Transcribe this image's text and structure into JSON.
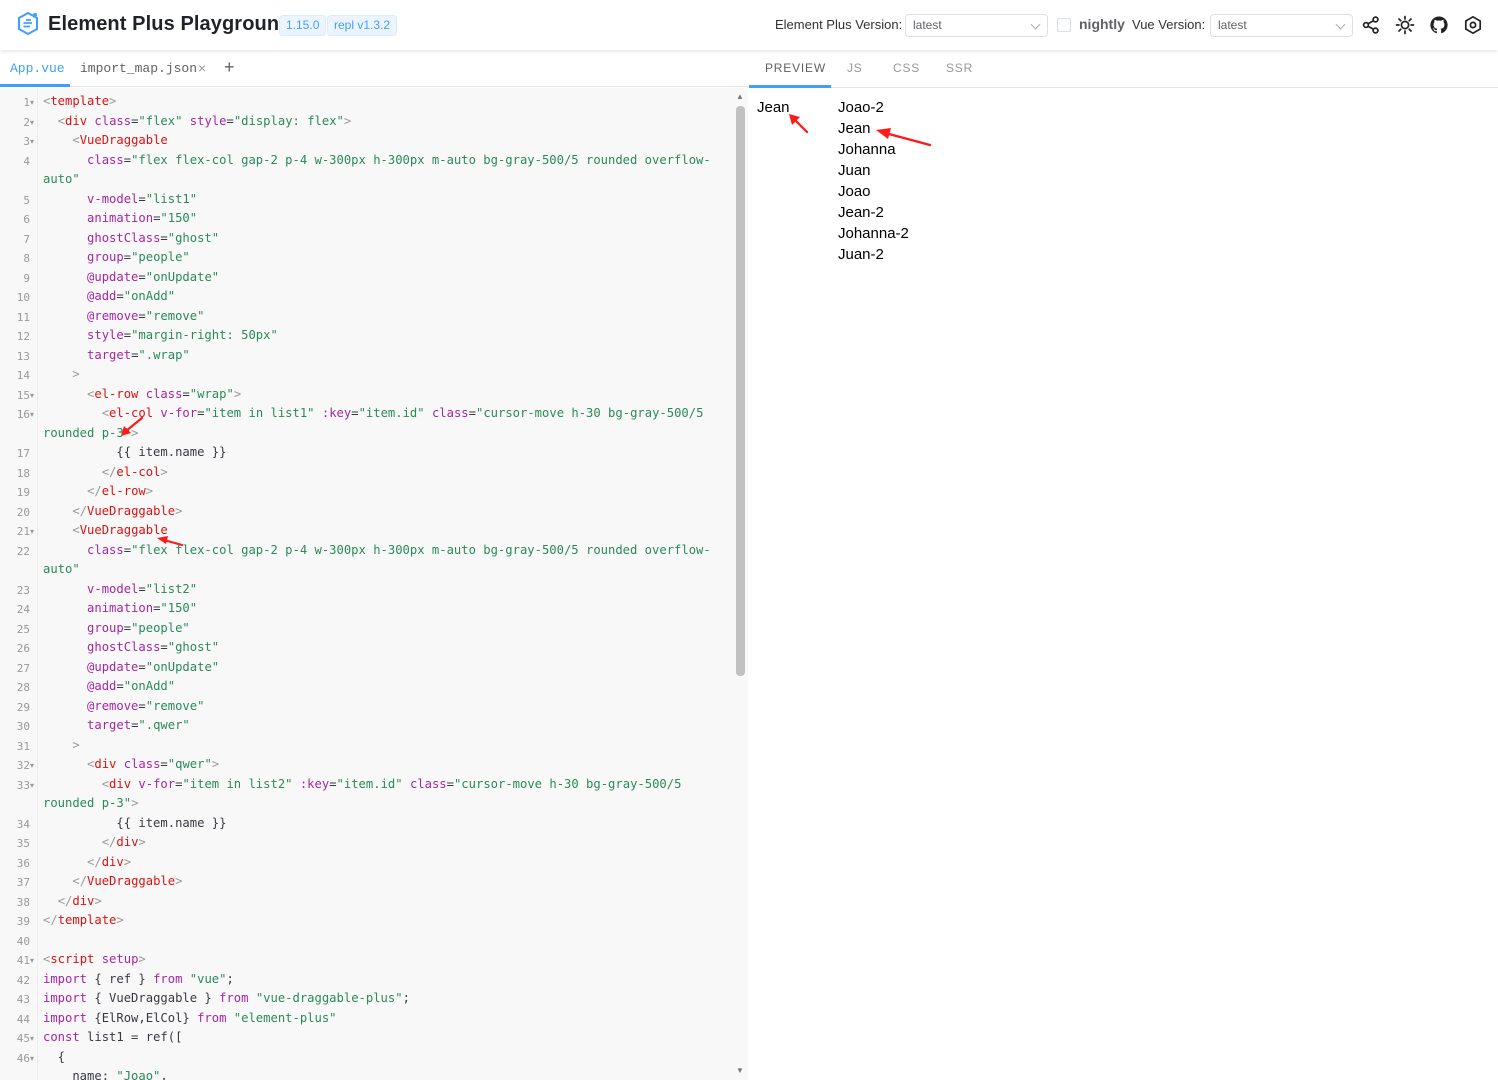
{
  "header": {
    "title": "Element Plus Playground",
    "badges": [
      "1.15.0",
      "repl v1.3.2"
    ],
    "ep_version_label": "Element Plus Version:",
    "ep_version_value": "latest",
    "nightly_label": "nightly",
    "vue_version_label": "Vue Version:",
    "vue_version_value": "latest",
    "icons": [
      "share-icon",
      "sun-icon",
      "github-icon",
      "settings-icon"
    ]
  },
  "file_tabs": [
    "App.vue",
    "import_map.json",
    "×",
    "+"
  ],
  "preview_tabs": [
    "PREVIEW",
    "JS",
    "CSS",
    "SSR"
  ],
  "code": [
    {
      "n": "1",
      "f": true,
      "t": [
        [
          "p",
          "<"
        ],
        [
          "t",
          "template"
        ],
        [
          "p",
          ">"
        ]
      ]
    },
    {
      "n": "2",
      "f": true,
      "t": [
        [
          "d",
          "  "
        ],
        [
          "p",
          "<"
        ],
        [
          "t",
          "div"
        ],
        [
          "d",
          " "
        ],
        [
          "a",
          "class"
        ],
        [
          "d",
          "="
        ],
        [
          "s",
          "\"flex\""
        ],
        [
          "d",
          " "
        ],
        [
          "a",
          "style"
        ],
        [
          "d",
          "="
        ],
        [
          "s",
          "\"display: flex\""
        ],
        [
          "p",
          ">"
        ]
      ]
    },
    {
      "n": "3",
      "f": true,
      "t": [
        [
          "d",
          "    "
        ],
        [
          "p",
          "<"
        ],
        [
          "t",
          "VueDraggable"
        ]
      ]
    },
    {
      "n": "4",
      "f": false,
      "t": [
        [
          "d",
          "      "
        ],
        [
          "a",
          "class"
        ],
        [
          "d",
          "="
        ],
        [
          "s",
          "\"flex flex-col gap-2 p-4 w-300px h-300px m-auto bg-gray-500/5 rounded overflow-"
        ]
      ]
    },
    {
      "n": "",
      "f": false,
      "t": [
        [
          "s",
          "auto\""
        ]
      ]
    },
    {
      "n": "5",
      "f": false,
      "t": [
        [
          "d",
          "      "
        ],
        [
          "a",
          "v-model"
        ],
        [
          "d",
          "="
        ],
        [
          "s",
          "\"list1\""
        ]
      ]
    },
    {
      "n": "6",
      "f": false,
      "t": [
        [
          "d",
          "      "
        ],
        [
          "a",
          "animation"
        ],
        [
          "d",
          "="
        ],
        [
          "s",
          "\"150\""
        ]
      ]
    },
    {
      "n": "7",
      "f": false,
      "t": [
        [
          "d",
          "      "
        ],
        [
          "a",
          "ghostClass"
        ],
        [
          "d",
          "="
        ],
        [
          "s",
          "\"ghost\""
        ]
      ]
    },
    {
      "n": "8",
      "f": false,
      "t": [
        [
          "d",
          "      "
        ],
        [
          "a",
          "group"
        ],
        [
          "d",
          "="
        ],
        [
          "s",
          "\"people\""
        ]
      ]
    },
    {
      "n": "9",
      "f": false,
      "t": [
        [
          "d",
          "      "
        ],
        [
          "a",
          "@update"
        ],
        [
          "d",
          "="
        ],
        [
          "s",
          "\"onUpdate\""
        ]
      ]
    },
    {
      "n": "10",
      "f": false,
      "t": [
        [
          "d",
          "      "
        ],
        [
          "a",
          "@add"
        ],
        [
          "d",
          "="
        ],
        [
          "s",
          "\"onAdd\""
        ]
      ]
    },
    {
      "n": "11",
      "f": false,
      "t": [
        [
          "d",
          "      "
        ],
        [
          "a",
          "@remove"
        ],
        [
          "d",
          "="
        ],
        [
          "s",
          "\"remove\""
        ]
      ]
    },
    {
      "n": "12",
      "f": false,
      "t": [
        [
          "d",
          "      "
        ],
        [
          "a",
          "style"
        ],
        [
          "d",
          "="
        ],
        [
          "s",
          "\"margin-right: 50px\""
        ]
      ]
    },
    {
      "n": "13",
      "f": false,
      "t": [
        [
          "d",
          "      "
        ],
        [
          "a",
          "target"
        ],
        [
          "d",
          "="
        ],
        [
          "s",
          "\".wrap\""
        ]
      ]
    },
    {
      "n": "14",
      "f": false,
      "t": [
        [
          "d",
          "    "
        ],
        [
          "p",
          ">"
        ]
      ]
    },
    {
      "n": "15",
      "f": true,
      "t": [
        [
          "d",
          "      "
        ],
        [
          "p",
          "<"
        ],
        [
          "t",
          "el-row"
        ],
        [
          "d",
          " "
        ],
        [
          "a",
          "class"
        ],
        [
          "d",
          "="
        ],
        [
          "s",
          "\"wrap\""
        ],
        [
          "p",
          ">"
        ]
      ]
    },
    {
      "n": "16",
      "f": true,
      "t": [
        [
          "d",
          "        "
        ],
        [
          "p",
          "<"
        ],
        [
          "t",
          "el-col"
        ],
        [
          "d",
          " "
        ],
        [
          "a",
          "v-for"
        ],
        [
          "d",
          "="
        ],
        [
          "s",
          "\"item in list1\""
        ],
        [
          "d",
          " "
        ],
        [
          "a",
          ":key"
        ],
        [
          "d",
          "="
        ],
        [
          "s",
          "\"item.id\""
        ],
        [
          "d",
          " "
        ],
        [
          "a",
          "class"
        ],
        [
          "d",
          "="
        ],
        [
          "s",
          "\"cursor-move h-30 bg-gray-500/5"
        ]
      ]
    },
    {
      "n": "",
      "f": false,
      "t": [
        [
          "s",
          "rounded p-3\""
        ],
        [
          "p",
          ">"
        ]
      ]
    },
    {
      "n": "17",
      "f": false,
      "t": [
        [
          "d",
          "          {{ item.name }}"
        ]
      ]
    },
    {
      "n": "18",
      "f": false,
      "t": [
        [
          "d",
          "        "
        ],
        [
          "p",
          "</"
        ],
        [
          "t",
          "el-col"
        ],
        [
          "p",
          ">"
        ]
      ]
    },
    {
      "n": "19",
      "f": false,
      "t": [
        [
          "d",
          "      "
        ],
        [
          "p",
          "</"
        ],
        [
          "t",
          "el-row"
        ],
        [
          "p",
          ">"
        ]
      ]
    },
    {
      "n": "20",
      "f": false,
      "t": [
        [
          "d",
          "    "
        ],
        [
          "p",
          "</"
        ],
        [
          "t",
          "VueDraggable"
        ],
        [
          "p",
          ">"
        ]
      ]
    },
    {
      "n": "21",
      "f": true,
      "t": [
        [
          "d",
          "    "
        ],
        [
          "p",
          "<"
        ],
        [
          "t",
          "VueDraggable"
        ]
      ]
    },
    {
      "n": "22",
      "f": false,
      "t": [
        [
          "d",
          "      "
        ],
        [
          "a",
          "class"
        ],
        [
          "d",
          "="
        ],
        [
          "s",
          "\"flex flex-col gap-2 p-4 w-300px h-300px m-auto bg-gray-500/5 rounded overflow-"
        ]
      ]
    },
    {
      "n": "",
      "f": false,
      "t": [
        [
          "s",
          "auto\""
        ]
      ]
    },
    {
      "n": "23",
      "f": false,
      "t": [
        [
          "d",
          "      "
        ],
        [
          "a",
          "v-model"
        ],
        [
          "d",
          "="
        ],
        [
          "s",
          "\"list2\""
        ]
      ]
    },
    {
      "n": "24",
      "f": false,
      "t": [
        [
          "d",
          "      "
        ],
        [
          "a",
          "animation"
        ],
        [
          "d",
          "="
        ],
        [
          "s",
          "\"150\""
        ]
      ]
    },
    {
      "n": "25",
      "f": false,
      "t": [
        [
          "d",
          "      "
        ],
        [
          "a",
          "group"
        ],
        [
          "d",
          "="
        ],
        [
          "s",
          "\"people\""
        ]
      ]
    },
    {
      "n": "26",
      "f": false,
      "t": [
        [
          "d",
          "      "
        ],
        [
          "a",
          "ghostClass"
        ],
        [
          "d",
          "="
        ],
        [
          "s",
          "\"ghost\""
        ]
      ]
    },
    {
      "n": "27",
      "f": false,
      "t": [
        [
          "d",
          "      "
        ],
        [
          "a",
          "@update"
        ],
        [
          "d",
          "="
        ],
        [
          "s",
          "\"onUpdate\""
        ]
      ]
    },
    {
      "n": "28",
      "f": false,
      "t": [
        [
          "d",
          "      "
        ],
        [
          "a",
          "@add"
        ],
        [
          "d",
          "="
        ],
        [
          "s",
          "\"onAdd\""
        ]
      ]
    },
    {
      "n": "29",
      "f": false,
      "t": [
        [
          "d",
          "      "
        ],
        [
          "a",
          "@remove"
        ],
        [
          "d",
          "="
        ],
        [
          "s",
          "\"remove\""
        ]
      ]
    },
    {
      "n": "30",
      "f": false,
      "t": [
        [
          "d",
          "      "
        ],
        [
          "a",
          "target"
        ],
        [
          "d",
          "="
        ],
        [
          "s",
          "\".qwer\""
        ]
      ]
    },
    {
      "n": "31",
      "f": false,
      "t": [
        [
          "d",
          "    "
        ],
        [
          "p",
          ">"
        ]
      ]
    },
    {
      "n": "32",
      "f": true,
      "t": [
        [
          "d",
          "      "
        ],
        [
          "p",
          "<"
        ],
        [
          "t",
          "div"
        ],
        [
          "d",
          " "
        ],
        [
          "a",
          "class"
        ],
        [
          "d",
          "="
        ],
        [
          "s",
          "\"qwer\""
        ],
        [
          "p",
          ">"
        ]
      ]
    },
    {
      "n": "33",
      "f": true,
      "t": [
        [
          "d",
          "        "
        ],
        [
          "p",
          "<"
        ],
        [
          "t",
          "div"
        ],
        [
          "d",
          " "
        ],
        [
          "a",
          "v-for"
        ],
        [
          "d",
          "="
        ],
        [
          "s",
          "\"item in list2\""
        ],
        [
          "d",
          " "
        ],
        [
          "a",
          ":key"
        ],
        [
          "d",
          "="
        ],
        [
          "s",
          "\"item.id\""
        ],
        [
          "d",
          " "
        ],
        [
          "a",
          "class"
        ],
        [
          "d",
          "="
        ],
        [
          "s",
          "\"cursor-move h-30 bg-gray-500/5"
        ]
      ]
    },
    {
      "n": "",
      "f": false,
      "t": [
        [
          "s",
          "rounded p-3\""
        ],
        [
          "p",
          ">"
        ]
      ]
    },
    {
      "n": "34",
      "f": false,
      "t": [
        [
          "d",
          "          {{ item.name }}"
        ]
      ]
    },
    {
      "n": "35",
      "f": false,
      "t": [
        [
          "d",
          "        "
        ],
        [
          "p",
          "</"
        ],
        [
          "t",
          "div"
        ],
        [
          "p",
          ">"
        ]
      ]
    },
    {
      "n": "36",
      "f": false,
      "t": [
        [
          "d",
          "      "
        ],
        [
          "p",
          "</"
        ],
        [
          "t",
          "div"
        ],
        [
          "p",
          ">"
        ]
      ]
    },
    {
      "n": "37",
      "f": false,
      "t": [
        [
          "d",
          "    "
        ],
        [
          "p",
          "</"
        ],
        [
          "t",
          "VueDraggable"
        ],
        [
          "p",
          ">"
        ]
      ]
    },
    {
      "n": "38",
      "f": false,
      "t": [
        [
          "d",
          "  "
        ],
        [
          "p",
          "</"
        ],
        [
          "t",
          "div"
        ],
        [
          "p",
          ">"
        ]
      ]
    },
    {
      "n": "39",
      "f": false,
      "t": [
        [
          "p",
          "</"
        ],
        [
          "t",
          "template"
        ],
        [
          "p",
          ">"
        ]
      ]
    },
    {
      "n": "40",
      "f": false,
      "t": [
        [
          "d",
          ""
        ]
      ]
    },
    {
      "n": "41",
      "f": true,
      "t": [
        [
          "p",
          "<"
        ],
        [
          "t",
          "script"
        ],
        [
          "d",
          " "
        ],
        [
          "a",
          "setup"
        ],
        [
          "p",
          ">"
        ]
      ]
    },
    {
      "n": "42",
      "f": false,
      "t": [
        [
          "k",
          "import"
        ],
        [
          "d",
          " { ref } "
        ],
        [
          "k",
          "from"
        ],
        [
          "d",
          " "
        ],
        [
          "s",
          "\"vue\""
        ],
        [
          "d",
          ";"
        ]
      ]
    },
    {
      "n": "43",
      "f": false,
      "t": [
        [
          "k",
          "import"
        ],
        [
          "d",
          " { VueDraggable } "
        ],
        [
          "k",
          "from"
        ],
        [
          "d",
          " "
        ],
        [
          "s",
          "\"vue-draggable-plus\""
        ],
        [
          "d",
          ";"
        ]
      ]
    },
    {
      "n": "44",
      "f": false,
      "t": [
        [
          "k",
          "import"
        ],
        [
          "d",
          " {ElRow,ElCol} "
        ],
        [
          "k",
          "from"
        ],
        [
          "d",
          " "
        ],
        [
          "s",
          "\"element-plus\""
        ]
      ]
    },
    {
      "n": "45",
      "f": true,
      "t": [
        [
          "k",
          "const"
        ],
        [
          "d",
          " list1 = ref(["
        ]
      ]
    },
    {
      "n": "46",
      "f": true,
      "t": [
        [
          "d",
          "  {"
        ]
      ]
    },
    {
      "n": "",
      "f": false,
      "t": [
        [
          "d",
          "    name: "
        ],
        [
          "s",
          "\"Joao\""
        ],
        [
          "d",
          ","
        ]
      ]
    }
  ],
  "preview": {
    "list1": [
      "Jean"
    ],
    "list2": [
      "Joao-2",
      "Jean",
      "Johanna",
      "Juan",
      "Joao",
      "Jean-2",
      "Johanna-2",
      "Juan-2"
    ]
  },
  "colors": {
    "accent": "#409eff",
    "annotation_arrow": "#ff0000"
  }
}
